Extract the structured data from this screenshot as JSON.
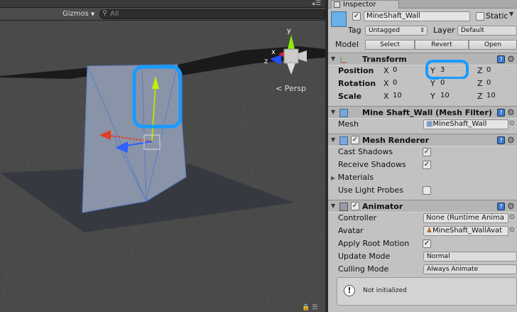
{
  "scene": {
    "gizmos_label": "Gizmos",
    "search_placeholder": "All",
    "persp_label": "Persp",
    "axis_y": "y",
    "axis_x": "x",
    "axis_z": "z",
    "colors": {
      "background": "#4a4a4a",
      "floor": "#363a40",
      "wall": "#8a94a8",
      "ceiling": "#1a1a1a",
      "highlight": "#1a9bff"
    }
  },
  "inspector": {
    "tab_label": "Inspector",
    "object": {
      "name": "MineShaft_Wall",
      "static_label": "Static",
      "tag_label": "Tag",
      "tag_value": "Untagged",
      "layer_label": "Layer",
      "layer_value": "Default",
      "model_label": "Model",
      "select_label": "Select",
      "revert_label": "Revert",
      "open_label": "Open"
    },
    "transform": {
      "title": "Transform",
      "position_label": "Position",
      "rotation_label": "Rotation",
      "scale_label": "Scale",
      "position": {
        "x": "0",
        "y": "3",
        "z": "0"
      },
      "rotation": {
        "x": "0",
        "y": "0",
        "z": "0"
      },
      "scale": {
        "x": "10",
        "y": "10",
        "z": "10"
      }
    },
    "mesh_filter": {
      "title": "Mine Shaft_Wall (Mesh Filter)",
      "mesh_label": "Mesh",
      "mesh_value": "MineShaft_Wall"
    },
    "mesh_renderer": {
      "title": "Mesh Renderer",
      "cast_shadows_label": "Cast Shadows",
      "receive_shadows_label": "Receive Shadows",
      "materials_label": "Materials",
      "use_light_probes_label": "Use Light Probes"
    },
    "animator": {
      "title": "Animator",
      "controller_label": "Controller",
      "controller_value": "None (Runtime Anima",
      "avatar_label": "Avatar",
      "avatar_value": "MineShaft_WallAvat",
      "apply_root_motion_label": "Apply Root Motion",
      "update_mode_label": "Update Mode",
      "update_mode_value": "Normal",
      "culling_mode_label": "Culling Mode",
      "culling_mode_value": "Always Animate",
      "not_initialized": "Not initialized"
    },
    "axis_labels": {
      "x": "X",
      "y": "Y",
      "z": "Z"
    }
  }
}
